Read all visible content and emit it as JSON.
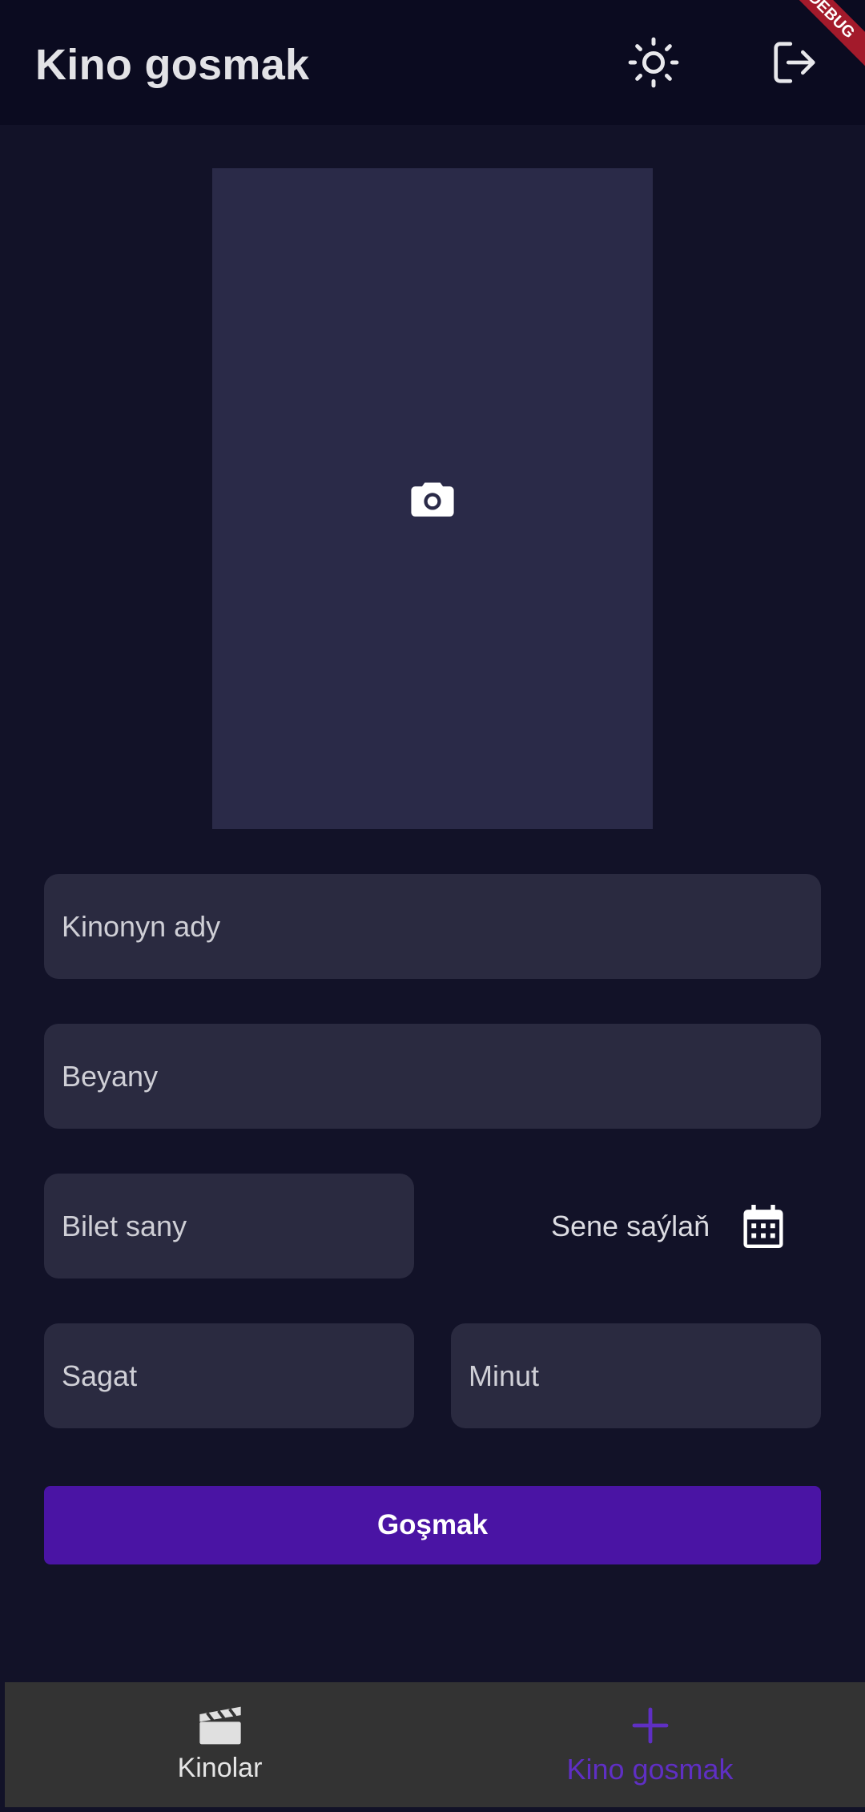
{
  "app_bar": {
    "title": "Kino gosmak",
    "theme_icon": "sun-icon",
    "logout_icon": "logout-icon",
    "debug_banner": "DEBUG"
  },
  "image_picker": {
    "icon": "camera-icon"
  },
  "form": {
    "title_field": {
      "placeholder": "Kinonyn ady"
    },
    "description_field": {
      "placeholder": "Beyany"
    },
    "ticket_count_field": {
      "placeholder": "Bilet sany"
    },
    "date_picker": {
      "label": "Sene saýlaň",
      "icon": "calendar-icon"
    },
    "hour_field": {
      "placeholder": "Sagat"
    },
    "minute_field": {
      "placeholder": "Minut"
    },
    "submit_label": "Goşmak"
  },
  "bottom_nav": {
    "items": [
      {
        "label": "Kinolar",
        "icon": "clapperboard-icon",
        "active": false
      },
      {
        "label": "Kino gosmak",
        "icon": "plus-icon",
        "active": true
      }
    ]
  },
  "colors": {
    "background": "#121228",
    "app_bar": "#0b0b20",
    "field": "#2a2a40",
    "image_placeholder": "#2a2a48",
    "primary_button": "#4a14a4",
    "nav_active": "#5f2fc4",
    "bottom_nav": "#333333"
  }
}
